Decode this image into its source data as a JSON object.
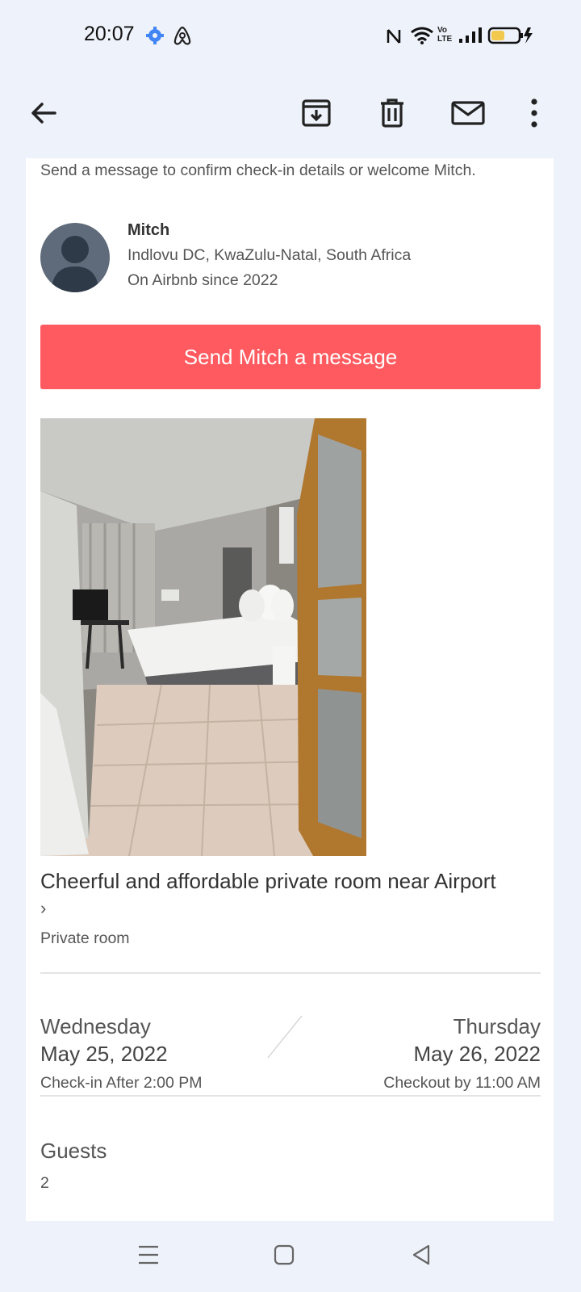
{
  "status_bar": {
    "time": "20:07",
    "icons": [
      "settings-gear-icon",
      "airbnb-notification-icon",
      "nfc-icon",
      "wifi-icon",
      "volte-icon",
      "signal-icon",
      "battery-charging-icon"
    ],
    "volte_label": "Vo LTE",
    "accent": "#4285f4"
  },
  "app_bar": {
    "actions": [
      "back-arrow-icon",
      "archive-icon",
      "trash-icon",
      "mail-icon",
      "more-vert-icon"
    ]
  },
  "hint_text": "Send a message to confirm check-in details or welcome Mitch.",
  "host": {
    "name": "Mitch",
    "location": "Indlovu DC, KwaZulu-Natal, South Africa",
    "member_since": "On Airbnb since 2022"
  },
  "message_button": {
    "label": "Send Mitch a message",
    "color": "#ff5a5f"
  },
  "listing": {
    "title": "Cheerful and affordable private room near Airport",
    "chevron": "›",
    "room_type": "Private room"
  },
  "check_in": {
    "day": "Wednesday",
    "date": "May 25, 2022",
    "time": "Check-in After 2:00 PM"
  },
  "check_out": {
    "day": "Thursday",
    "date": "May 26, 2022",
    "time": "Checkout by 11:00 AM"
  },
  "guests": {
    "label": "Guests",
    "value": "2"
  },
  "nav_bar": {
    "buttons": [
      "menu-icon",
      "home-icon",
      "back-icon"
    ]
  }
}
